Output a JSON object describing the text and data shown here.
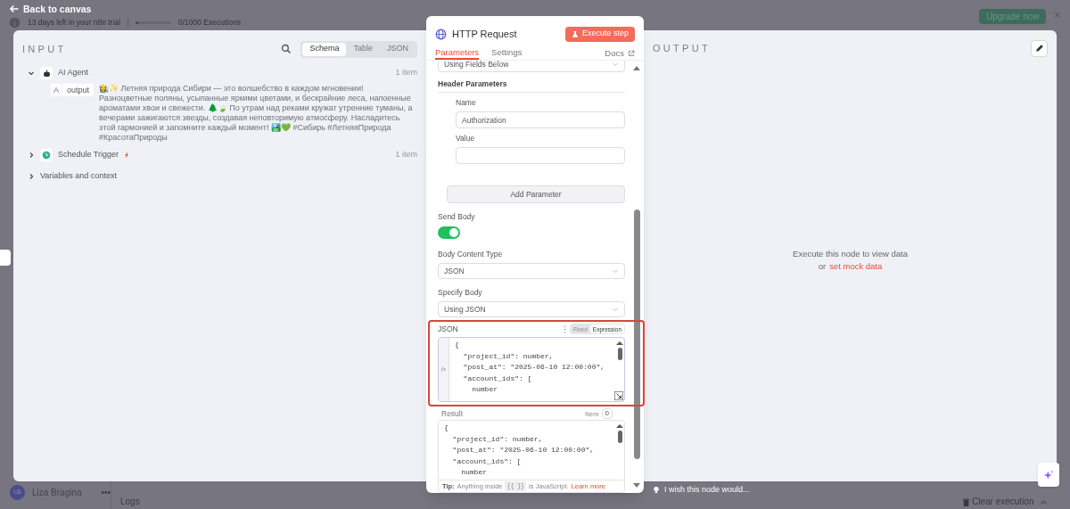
{
  "top_bar": {
    "back_link": "Back to canvas",
    "trial_text": "13 days left in your n8n trial",
    "executions": "0/1000 Executions",
    "upgrade_button": "Upgrade now",
    "close": "×"
  },
  "input": {
    "title": "INPUT",
    "view_tabs": [
      {
        "label": "Schema",
        "selected": true
      },
      {
        "label": "Table",
        "selected": false
      },
      {
        "label": "JSON",
        "selected": false
      }
    ],
    "nodes": [
      {
        "kind": "agent",
        "name": "AI Agent",
        "count": "1 item",
        "expanded": true,
        "fields": [
          {
            "type": "A",
            "key": "output",
            "value": "👩‍🌾✨ Летняя природа Сибири — это волшебство в каждом мгновении! Разноцветные поляны, усыпанные яркими цветами, и бескрайние леса, напоенные ароматами хвои и свежести. 🌲🍃 По утрам над реками кружат утренние туманы, а вечерами зажигаются звезды, создавая неповторимую атмосферу. Насладитесь этой гармонией и запомните каждый момент! 🏞️💚 #Сибирь #ЛетняяПрирода #КрасотаПрироды"
          }
        ]
      },
      {
        "kind": "trigger",
        "name": "Schedule Trigger",
        "count": "1 item",
        "expanded": false
      }
    ],
    "variables": "Variables and context"
  },
  "node_panel": {
    "title": "HTTP Request",
    "execute_button": "Execute step",
    "tabs": [
      {
        "label": "Parameters",
        "selected": true
      },
      {
        "label": "Settings",
        "selected": false
      }
    ],
    "docs": "Docs",
    "top_select": "Using Fields Below",
    "header_section": "Header Parameters",
    "header_fields": [
      {
        "label": "Name",
        "value": "Authorization"
      },
      {
        "label": "Value"
      }
    ],
    "add_parameter": "Add Parameter",
    "send_body": {
      "label": "Send Body",
      "on": true
    },
    "selects": [
      {
        "label": "Body Content Type",
        "value": "JSON"
      },
      {
        "label": "Specify Body",
        "value": "Using JSON"
      }
    ],
    "json_field": {
      "label": "JSON",
      "modes": [
        {
          "label": "Fixed",
          "selected": false
        },
        {
          "label": "Expression",
          "selected": true
        }
      ],
      "gutter": "fx",
      "lines": [
        "{",
        "  \"project_id\": number,",
        "  \"post_at\": \"2025-06-10 12:00:00\",",
        "  \"account_ids\": [",
        "    number"
      ]
    },
    "result": {
      "label": "Result",
      "item_label": "Item",
      "item": "0",
      "lines": [
        "{",
        "  \"project_id\": number,",
        "  \"post_at\": \"2025-06-10 12:00:00\",",
        "  \"account_ids\": [",
        "    number"
      ]
    },
    "tip": {
      "label": "Tip:",
      "text": "Anything inside",
      "code": "{{ }}",
      "text_after": "is JavaScript.",
      "link": "Learn more"
    }
  },
  "output": {
    "title": "OUTPUT",
    "message": "Execute this node to view data",
    "or": "or",
    "mock_link": "set mock data"
  },
  "bottom": {
    "user": "Liza Bragina",
    "user_initials": "LB",
    "more": "•••",
    "logs": "Logs",
    "feedback": "I wish this node would...",
    "clear": "Clear execution"
  }
}
